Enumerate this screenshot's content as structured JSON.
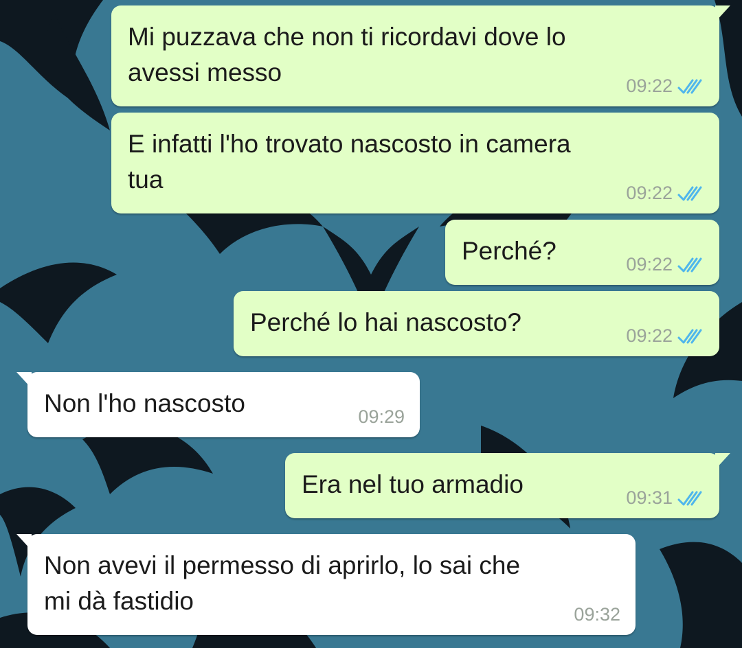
{
  "theme": {
    "outgoing_bubble": "#e2ffc6",
    "incoming_bubble": "#ffffff",
    "wallpaper_base": "#3e7f98",
    "wallpaper_pattern": "#0e1820",
    "read_ticks": "#4fb6ec",
    "time_text": "#9aa39a"
  },
  "messages": [
    {
      "direction": "outgoing",
      "text": "Mi puzzava che non ti ricordavi dove lo\navessi messo",
      "time": "09:22",
      "status": "read"
    },
    {
      "direction": "outgoing",
      "text": "E infatti l'ho trovato nascosto in camera\ntua",
      "time": "09:22",
      "status": "read"
    },
    {
      "direction": "outgoing",
      "text": "Perché?",
      "time": "09:22",
      "status": "read"
    },
    {
      "direction": "outgoing",
      "text": "Perché lo hai nascosto?",
      "time": "09:22",
      "status": "read"
    },
    {
      "direction": "incoming",
      "text": "Non l'ho nascosto",
      "time": "09:29"
    },
    {
      "direction": "outgoing",
      "text": "Era nel tuo armadio",
      "time": "09:31",
      "status": "read"
    },
    {
      "direction": "incoming",
      "text": "Non avevi il permesso di aprirlo, lo sai che\nmi dà fastidio",
      "time": "09:32"
    }
  ],
  "icons": {
    "read_receipt": "double-check-icon",
    "wallpaper": "tribal-wolf-pattern"
  }
}
